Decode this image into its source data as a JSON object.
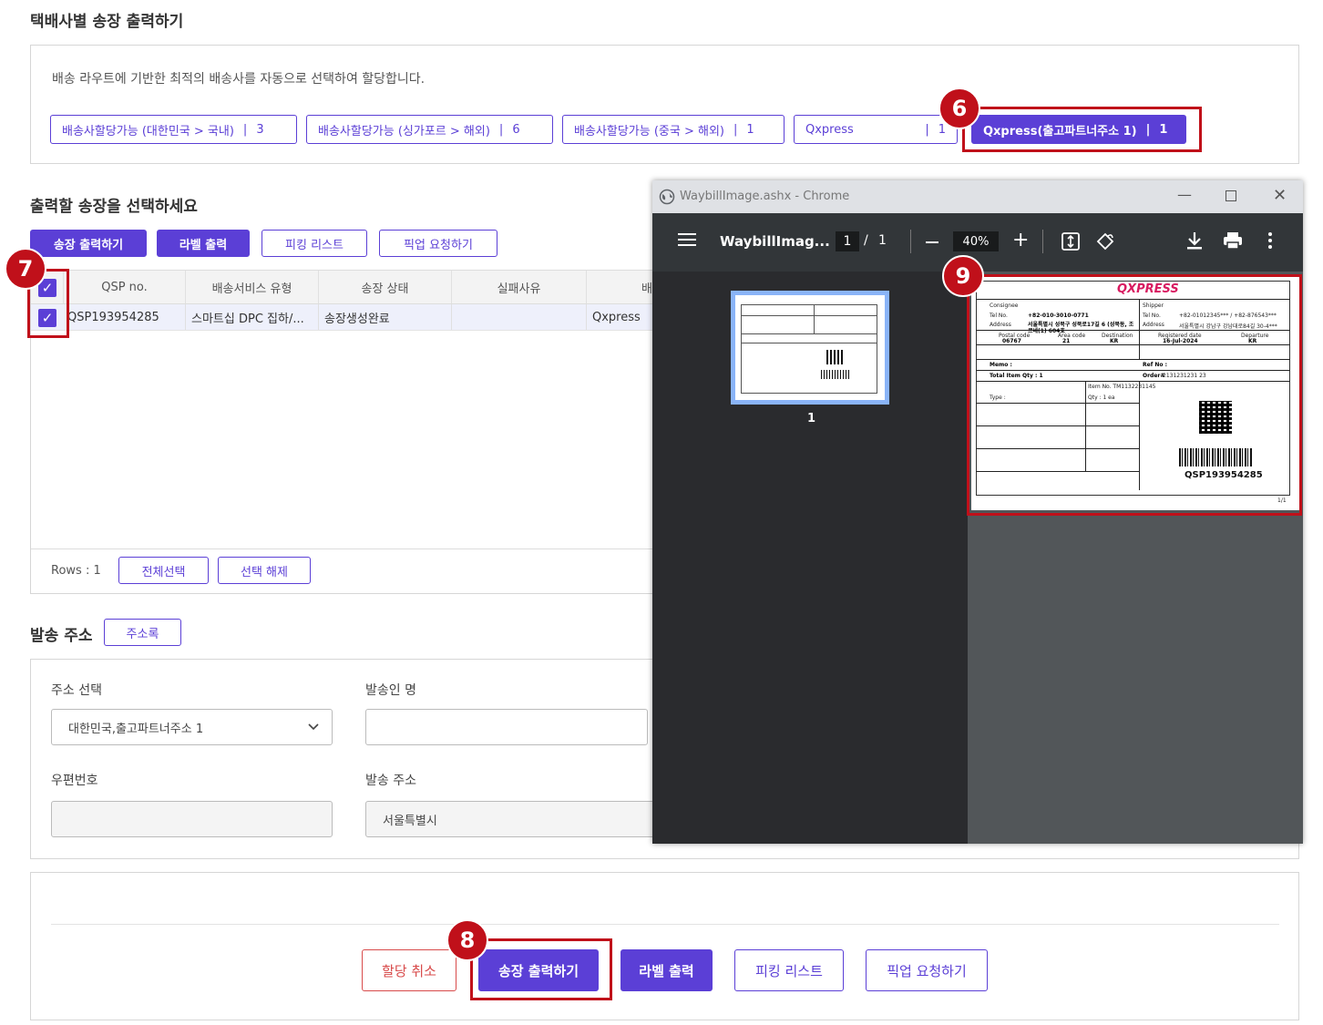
{
  "section1": {
    "title": "택배사별 송장 출력하기",
    "description": "배송 라우트에 기반한 최적의 배송사를 자동으로 선택하여 할당합니다.",
    "chips": [
      {
        "label": "배송사할당가능 (대한민국 > 국내)",
        "count": "3"
      },
      {
        "label": "배송사할당가능 (싱가포르 > 해외)",
        "count": "6"
      },
      {
        "label": "배송사할당가능 (중국 > 해외)",
        "count": "1"
      },
      {
        "label": "Qxpress",
        "count": "1"
      },
      {
        "label": "Qxpress(출고파트너주소 1)",
        "count": "1"
      }
    ]
  },
  "section2": {
    "title": "출력할 송장을 선택하세요",
    "buttons": {
      "print_waybill": "송장 출력하기",
      "print_label": "라벨 출력",
      "picking_list": "피킹 리스트",
      "pickup_request": "픽업 요청하기"
    },
    "columns": [
      "QSP no.",
      "배송서비스 유형",
      "송장 상태",
      "실패사유",
      "배"
    ],
    "rows": [
      {
        "qsp": "QSP193954285",
        "service": "스마트십 DPC 집하/...",
        "status": "송장생성완료",
        "reason": "",
        "carrier": "Qxpress"
      }
    ],
    "footer": {
      "rows_label": "Rows : 1",
      "select_all": "전체선택",
      "deselect": "선택 해제"
    }
  },
  "section3": {
    "title": "발송 주소",
    "address_book": "주소록",
    "address_select_label": "주소 선택",
    "address_select_value": "대한민국,출고파트너주소 1",
    "sender_label": "발송인 명",
    "sender_value": "",
    "zip_label": "우편번호",
    "zip_value": "",
    "address_label": "발송 주소",
    "address_value": "서울특별시"
  },
  "bottom": {
    "cancel": "할당 취소",
    "print_waybill": "송장 출력하기",
    "print_label": "라벨 출력",
    "picking_list": "피킹 리스트",
    "pickup_request": "픽업 요청하기"
  },
  "badges": {
    "six": "6",
    "seven": "7",
    "eight": "8",
    "nine": "9"
  },
  "chrome": {
    "window_title": "WaybillImage.ashx - Chrome",
    "doc_title": "WaybillImag...",
    "page_current": "1",
    "page_sep": "/",
    "page_total": "1",
    "zoom": "40%",
    "thumb_page": "1"
  },
  "waybill": {
    "brand": "QXPRESS",
    "consignee_label": "Consignee",
    "shipper_label": "Shipper",
    "tel_label": "Tel No.",
    "address_label": "Address",
    "consignee_tel": "+82-010-3010-0771",
    "shipper_tel": "+82-01012345*** / +82-876543***",
    "consignee_address": "서울특별시 성북구 성북로17길 6 (성북동, 조르네(1) 604호",
    "shipper_address": "서울특별시 강남구 강남대로84길 30-4***",
    "postal_code_label": "Postal code",
    "area_code_label": "Area code",
    "destination_label": "Destination",
    "registered_label": "Registered date",
    "departure_label": "Departure",
    "postal_code": "06767",
    "area_code": "21",
    "destination": "KR",
    "registered": "16-Jul-2024",
    "departure": "KR",
    "memo_label": "Memo :",
    "ref_label": "Ref No :",
    "total_label": "Total Item Qty : 1",
    "order_label": "Order#",
    "order_value": "2131231231 23",
    "item_no_label": "Item No. TM1132231145",
    "qty_label": "Qty : 1 ea",
    "type_label": "Type :",
    "barcode_text": "QSP193954285",
    "page_of": "1/1"
  },
  "colors": {
    "accent": "#5b3fd6",
    "highlight": "#c0101a",
    "danger": "#d84b4b"
  }
}
